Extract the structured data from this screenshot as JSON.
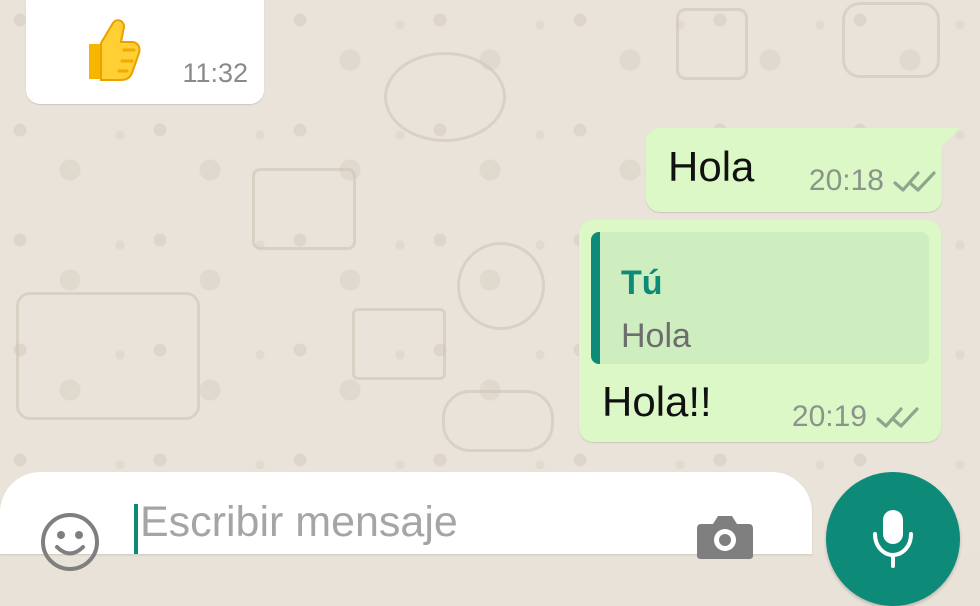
{
  "chat": {
    "incoming": {
      "emoji": "👍",
      "time": "11:32"
    },
    "messages": [
      {
        "text": "Hola",
        "time": "20:18",
        "status_icon": "double-check-icon"
      },
      {
        "quoted": {
          "author": "Tú",
          "text": "Hola"
        },
        "text": "Hola!!",
        "time": "20:19",
        "status_icon": "double-check-icon"
      }
    ]
  },
  "composer": {
    "placeholder": "Escribir mensaje",
    "value": ""
  },
  "icons": {
    "emoji": "emoji-icon",
    "camera": "camera-icon",
    "microphone": "microphone-icon"
  },
  "colors": {
    "incoming_bubble": "#ffffff",
    "outgoing_bubble": "#dcf8c6",
    "quote_background": "#cfeec0",
    "accent": "#0e8a79",
    "wallpaper": "#e9e3d9"
  }
}
